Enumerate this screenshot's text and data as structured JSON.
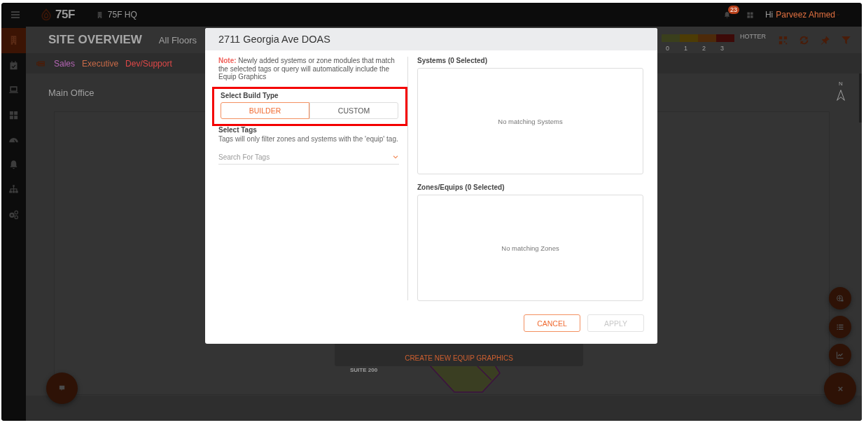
{
  "top_bar": {
    "brand": "75F",
    "site": "75F HQ",
    "notification_count": "23",
    "greeting": "Hi",
    "user_name": "Parveez Ahmed"
  },
  "sidebar": {
    "items": [
      {
        "kind": "building",
        "selected": true
      },
      {
        "kind": "calendar",
        "selected": false
      },
      {
        "kind": "laptop",
        "selected": false
      },
      {
        "kind": "grid",
        "selected": false
      },
      {
        "kind": "gauge",
        "selected": false
      },
      {
        "kind": "bell",
        "selected": false
      },
      {
        "kind": "sitemap",
        "selected": false
      },
      {
        "kind": "gears",
        "selected": false
      }
    ]
  },
  "header": {
    "title": "SITE OVERVIEW",
    "floor_filter": "All Floors",
    "legend": [
      {
        "label": "0",
        "color": "#3a3f1c"
      },
      {
        "label": "1",
        "color": "#4d3c05"
      },
      {
        "label": "2",
        "color": "#4d2a0a"
      },
      {
        "label": "3",
        "color": "#3d0a08"
      }
    ],
    "legend_end_label": "HOTTER"
  },
  "tags": [
    {
      "label": "Sales",
      "color": "#b565b5"
    },
    {
      "label": "Executive",
      "color": "#c86a48"
    },
    {
      "label": "Dev/Support",
      "color": "#e04848"
    }
  ],
  "floor": {
    "name": "Main Office",
    "compass_label": "N",
    "suite_label": "SUITE 200",
    "create_button": "CREATE NEW EQUIP GRAPHICS"
  },
  "modal": {
    "title": "2711 Georgia Ave DOAS",
    "note": "**Note:** Newly added systems or zone modules that match the selected tags or query will automatically include the Equip Graphics",
    "build_type": {
      "label": "Select Build Type",
      "highlighted": true,
      "options": [
        {
          "label": "BUILDER",
          "selected": true
        },
        {
          "label": "CUSTOM",
          "selected": false
        }
      ]
    },
    "tags_label": "Select Tags",
    "tags_hint": "Tags will only filter zones and systems with the 'equip' tag.",
    "tags_search": {
      "placeholder": "Search For Tags"
    },
    "systems": {
      "title": "Systems (0 Selected)",
      "empty_text": "No matching Systems"
    },
    "zones": {
      "title": "Zones/Equips (0 Selected)",
      "empty_text": "No matching Zones"
    },
    "buttons": [
      {
        "label": "CANCEL",
        "disabled": false
      },
      {
        "label": "APPLY",
        "disabled": true
      }
    ]
  },
  "fabs": [
    {
      "kind": "chat"
    },
    {
      "kind": "target"
    },
    {
      "kind": "list"
    },
    {
      "kind": "chart"
    },
    {
      "kind": "close"
    }
  ]
}
